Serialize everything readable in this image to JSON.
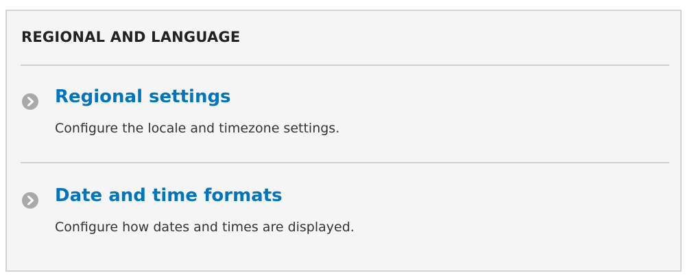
{
  "panel": {
    "title": "REGIONAL AND LANGUAGE"
  },
  "items": [
    {
      "label": "Regional settings",
      "description": "Configure the locale and timezone settings.",
      "icon": "chevron-circle-right-icon"
    },
    {
      "label": "Date and time formats",
      "description": "Configure how dates and times are displayed.",
      "icon": "chevron-circle-right-icon"
    }
  ],
  "colors": {
    "link": "#0074bd",
    "icon": "#a9a9a9",
    "panel_background": "#f5f5f5",
    "border": "#d4d4d4"
  }
}
